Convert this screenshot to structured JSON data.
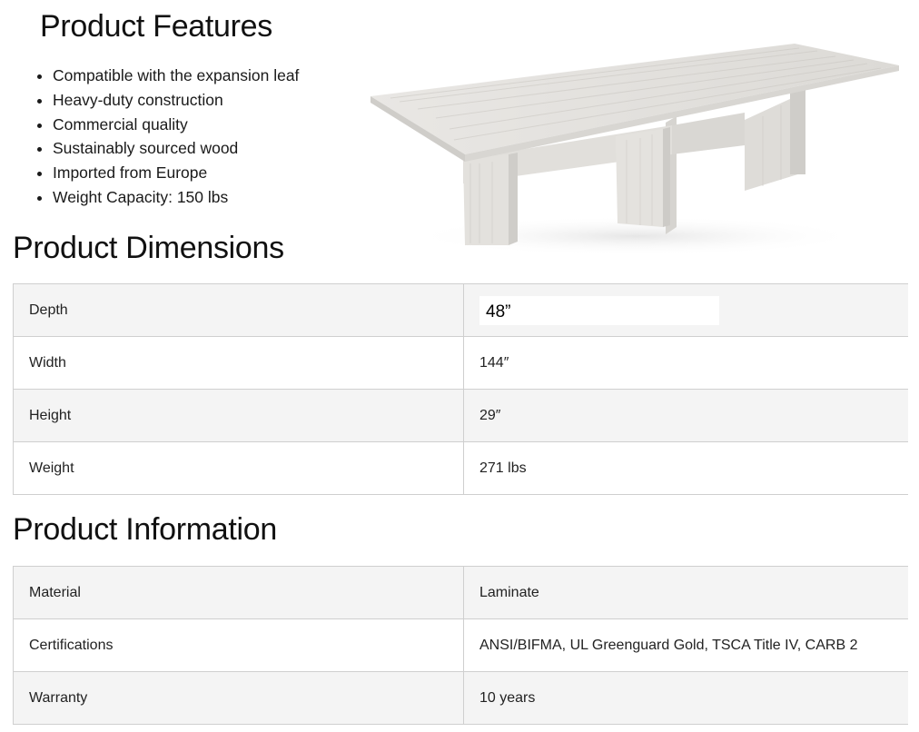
{
  "features": {
    "title": "Product Features",
    "items": [
      "Compatible with the expansion leaf",
      "Heavy-duty construction",
      "Commercial quality",
      "Sustainably sourced wood",
      "Imported from Europe",
      "Weight Capacity: 150 lbs"
    ]
  },
  "dimensions": {
    "title": "Product Dimensions",
    "rows": [
      {
        "label": "Depth",
        "value": "48”"
      },
      {
        "label": "Width",
        "value": "144″"
      },
      {
        "label": "Height",
        "value": "29″"
      },
      {
        "label": "Weight",
        "value": "271 lbs"
      }
    ]
  },
  "information": {
    "title": "Product Information",
    "rows": [
      {
        "label": "Material",
        "value": "Laminate"
      },
      {
        "label": "Certifications",
        "value": "ANSI/BIFMA, UL Greenguard Gold, TSCA Title IV, CARB 2"
      },
      {
        "label": "Warranty",
        "value": "10 years"
      }
    ]
  },
  "colors": {
    "table_border": "#cfcfcf",
    "row_shade": "#f4f4f4",
    "wood": "#e6e4e1"
  },
  "image": {
    "icon": "conference-table-image"
  }
}
